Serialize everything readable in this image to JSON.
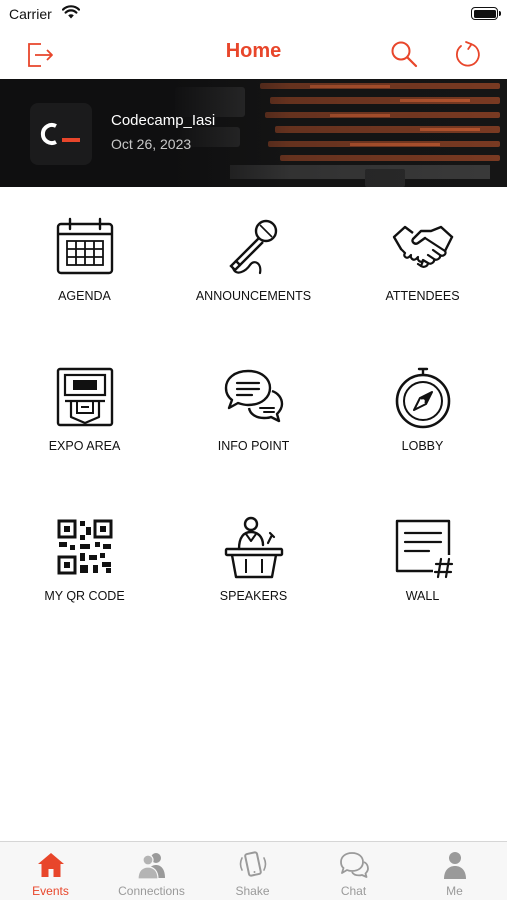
{
  "status_bar": {
    "carrier": "Carrier"
  },
  "nav": {
    "title": "Home"
  },
  "event": {
    "name": "Codecamp_Iasi",
    "date": "Oct 26, 2023"
  },
  "menu": [
    {
      "label": "AGENDA",
      "icon": "calendar-icon"
    },
    {
      "label": "ANNOUNCEMENTS",
      "icon": "microphone-icon"
    },
    {
      "label": "ATTENDEES",
      "icon": "handshake-icon"
    },
    {
      "label": "EXPO AREA",
      "icon": "atm-kiosk-icon"
    },
    {
      "label": "INFO POINT",
      "icon": "chat-bubbles-icon"
    },
    {
      "label": "LOBBY",
      "icon": "compass-icon"
    },
    {
      "label": "MY QR CODE",
      "icon": "qr-code-icon"
    },
    {
      "label": "SPEAKERS",
      "icon": "podium-speaker-icon"
    },
    {
      "label": "WALL",
      "icon": "wall-post-icon"
    }
  ],
  "tabs": [
    {
      "label": "Events",
      "icon": "home-icon",
      "active": true
    },
    {
      "label": "Connections",
      "icon": "people-icon",
      "active": false
    },
    {
      "label": "Shake",
      "icon": "shake-phone-icon",
      "active": false
    },
    {
      "label": "Chat",
      "icon": "chat-icon",
      "active": false
    },
    {
      "label": "Me",
      "icon": "person-icon",
      "active": false
    }
  ],
  "colors": {
    "accent": "#e8462b",
    "inactive": "#9a9a9a",
    "banner_bg": "#0f0f10"
  }
}
